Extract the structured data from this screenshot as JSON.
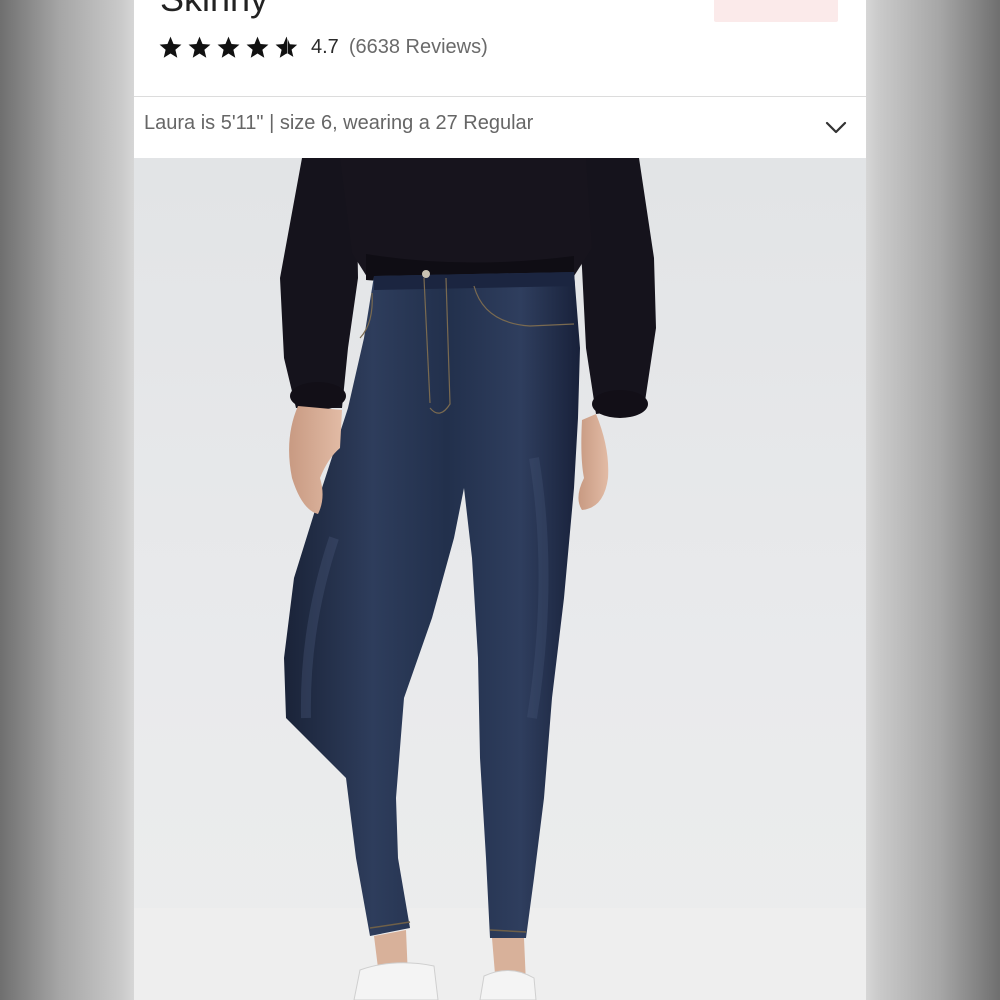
{
  "product": {
    "title": "Skinny",
    "rating": "4.7",
    "reviews": "(6638 Reviews)",
    "stars": [
      "star",
      "star",
      "star",
      "star",
      "star-half"
    ]
  },
  "fit_info": {
    "text": "Laura is 5'11\" | size 6, wearing a 27 Regular",
    "toggle_icon": "chevron-down-icon"
  },
  "colors": {
    "star": "#111111",
    "denim": "#1f2a44",
    "top": "#14121a",
    "page_bg": "#e6e8ea"
  }
}
